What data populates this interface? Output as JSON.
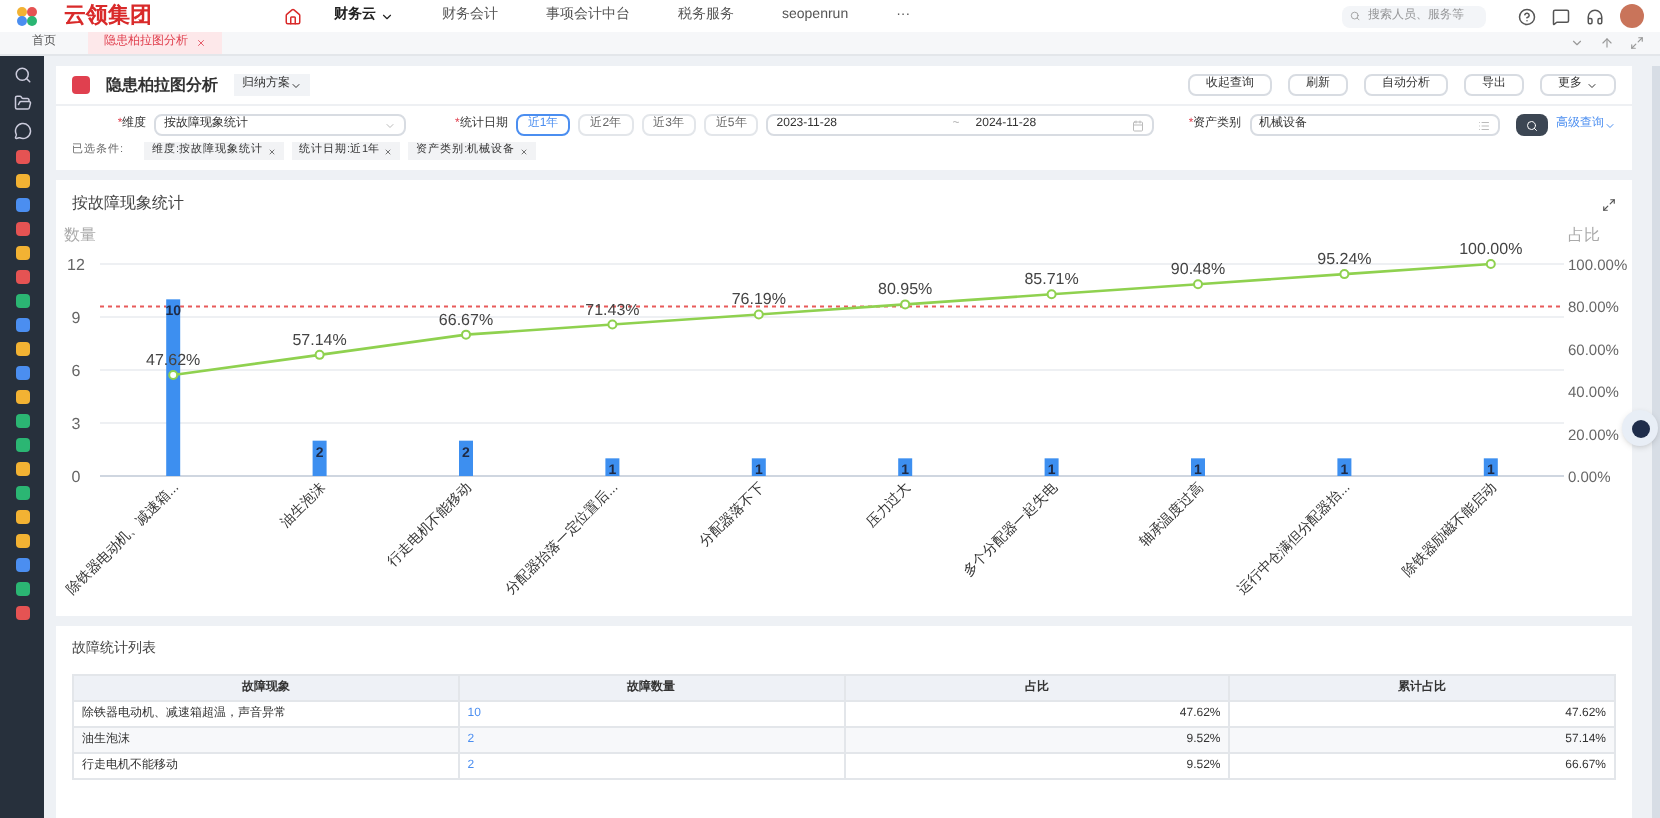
{
  "brand": {
    "name": "云领集团"
  },
  "nav": [
    {
      "label": "财务云",
      "selected": true
    },
    {
      "label": "财务会计",
      "selected": false
    },
    {
      "label": "事项会计中台",
      "selected": false
    },
    {
      "label": "税务服务",
      "selected": false
    },
    {
      "label": "seopenrun",
      "selected": false
    },
    {
      "label": "···",
      "selected": false
    }
  ],
  "top_search": {
    "placeholder": "搜索人员、服务等"
  },
  "tabs": [
    {
      "label": "首页",
      "selected": false,
      "closable": false
    },
    {
      "label": "隐患柏拉图分析",
      "selected": true,
      "closable": true
    }
  ],
  "page": {
    "title": "隐患柏拉图分析",
    "scheme_button": "归纳方案",
    "actions": [
      "收起查询",
      "刷新",
      "自动分析",
      "导出",
      "更多"
    ]
  },
  "filters": {
    "required_mark": "*",
    "dimension": {
      "label": "维度",
      "value": "按故障现象统计"
    },
    "date": {
      "label": "统计日期",
      "ranges": [
        {
          "label": "近1年",
          "selected": true
        },
        {
          "label": "近2年",
          "selected": false
        },
        {
          "label": "近3年",
          "selected": false
        },
        {
          "label": "近5年",
          "selected": false
        }
      ],
      "start": "2023-11-28",
      "separator": "~",
      "end": "2024-11-28"
    },
    "asset": {
      "label": "资产类别",
      "value": "机械设备"
    },
    "advanced": "高级查询"
  },
  "selected_conditions": {
    "label": "已选条件:",
    "tags": [
      "维度:按故障现象统计",
      "统计日期:近1年",
      "资产类别:机械设备"
    ]
  },
  "chart_card": {
    "title": "按故障现象统计",
    "chart_data": {
      "type": "bar",
      "ylabel": "数量",
      "y2label": "占比",
      "grid": true,
      "categories": [
        "除铁器电动机、减速箱...",
        "油生泡沫",
        "行走电机不能移动",
        "分配器抬落一定位置后...",
        "分配器落不下",
        "压力过大",
        "多个分配器一起失电",
        "轴承温度过高",
        "运行中仓满但分配器抬...",
        "除铁器励磁不能启动"
      ],
      "series": [
        {
          "type": "bar",
          "color": "#3d8ff0",
          "values": [
            10,
            2,
            2,
            1,
            1,
            1,
            1,
            1,
            1,
            1
          ],
          "value_labels": [
            "10",
            "2",
            "2",
            "1",
            "1",
            "1",
            "1",
            "1",
            "1",
            "1"
          ]
        },
        {
          "type": "line",
          "axis": "y2",
          "marker": "circle",
          "color": "#8fd14f",
          "values": [
            47.62,
            57.14,
            66.67,
            71.43,
            76.19,
            80.95,
            85.71,
            90.48,
            95.24,
            100.0
          ],
          "value_labels": [
            "47.62%",
            "57.14%",
            "66.67%",
            "71.43%",
            "76.19%",
            "80.95%",
            "85.71%",
            "90.48%",
            "95.24%",
            "100.00%"
          ]
        }
      ],
      "ylim": [
        0,
        12
      ],
      "yticks": [
        0,
        3,
        6,
        9,
        12
      ],
      "y2lim": [
        0,
        100
      ],
      "y2ticks": [
        {
          "value": 0,
          "label": "0.00%"
        },
        {
          "value": 20,
          "label": "20.00%"
        },
        {
          "value": 40,
          "label": "40.00%"
        },
        {
          "value": 60,
          "label": "60.00%"
        },
        {
          "value": 80,
          "label": "80.00%"
        },
        {
          "value": 100,
          "label": "100.00%"
        }
      ],
      "data_labels": true,
      "ref_lines": [
        {
          "value": 80,
          "axis": "y2",
          "color": "#e85a5a"
        }
      ]
    }
  },
  "table_card": {
    "title": "故障统计列表",
    "columns": [
      "故障现象",
      "故障数量",
      "占比",
      "累计占比"
    ],
    "rows": [
      [
        "除铁器电动机、减速箱超温，声音异常",
        "10",
        "47.62%",
        "47.62%"
      ],
      [
        "油生泡沫",
        "2",
        "9.52%",
        "57.14%"
      ],
      [
        "行走电机不能移动",
        "2",
        "9.52%",
        "66.67%"
      ]
    ]
  }
}
